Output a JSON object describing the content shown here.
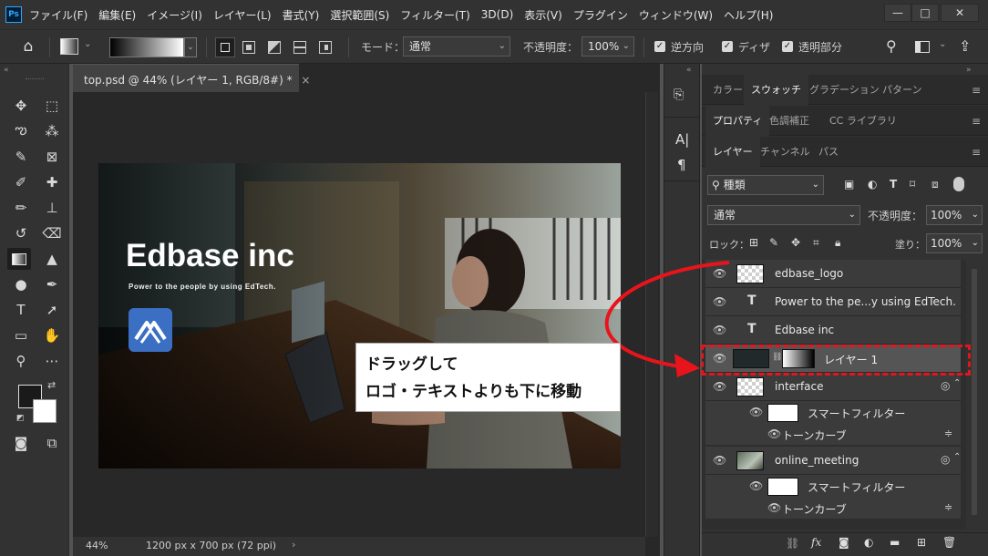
{
  "app": {
    "logo_text": "Ps"
  },
  "menu": [
    "ファイル(F)",
    "編集(E)",
    "イメージ(I)",
    "レイヤー(L)",
    "書式(Y)",
    "選択範囲(S)",
    "フィルター(T)",
    "3D(D)",
    "表示(V)",
    "プラグイン",
    "ウィンドウ(W)",
    "ヘルプ(H)"
  ],
  "window_controls": {
    "minimize": "—",
    "maximize": "□",
    "close": "✕"
  },
  "options_bar": {
    "mode_label": "モード：",
    "mode_value": "通常",
    "opacity_label": "不透明度：",
    "opacity_value": "100%",
    "reverse_label": "逆方向",
    "dither_label": "ディザ",
    "transparency_label": "透明部分"
  },
  "document": {
    "tab_title": "top.psd @ 44% (レイヤー 1, RGB/8#) *",
    "zoom": "44%",
    "dimensions": "1200 px x 700 px (72 ppi)"
  },
  "artwork": {
    "headline": "Edbase inc",
    "tagline": "Power to the people by using EdTech."
  },
  "panels": {
    "row1_tabs": [
      "カラー",
      "スウォッチ",
      "グラデーション",
      "パターン"
    ],
    "row2_tabs": [
      "プロパティ",
      "色調補正",
      "CC ライブラリ"
    ],
    "row3_tabs": [
      "レイヤー",
      "チャンネル",
      "パス"
    ],
    "filter_kind": "種類",
    "blend_mode": "通常",
    "opacity_label": "不透明度：",
    "opacity_value": "100%",
    "lock_label": "ロック：",
    "fill_label": "塗り：",
    "fill_value": "100%"
  },
  "layers": [
    {
      "name": "edbase_logo",
      "kind": "smart"
    },
    {
      "name": "Power to the pe...y using EdTech.",
      "kind": "text"
    },
    {
      "name": "Edbase inc",
      "kind": "text"
    },
    {
      "name": "レイヤー 1",
      "kind": "gradient",
      "selected": true
    },
    {
      "name": "interface",
      "kind": "smart",
      "subs": [
        "スマートフィルター",
        "トーンカーブ"
      ]
    },
    {
      "name": "online_meeting",
      "kind": "smart-photo",
      "subs": [
        "スマートフィルター",
        "トーンカーブ"
      ]
    }
  ],
  "callout": {
    "line1": "ドラッグして",
    "line2": "ロゴ・テキストよりも下に移動"
  },
  "colors": {
    "accent_red": "#e8141c",
    "logo_blue": "#3b6fc4"
  }
}
